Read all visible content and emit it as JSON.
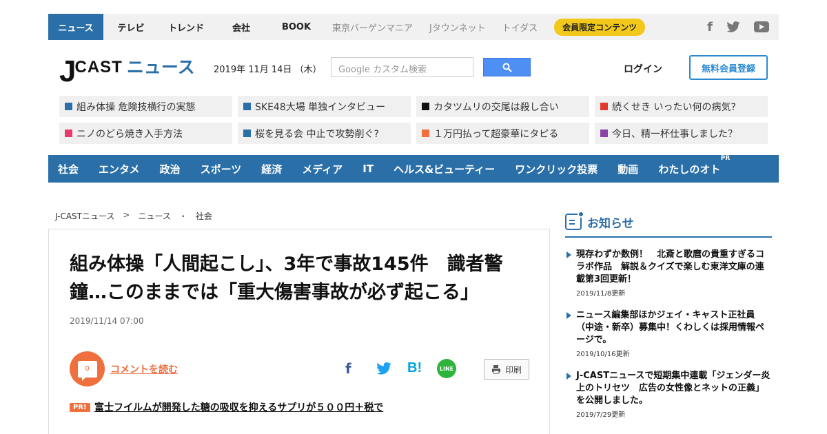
{
  "topnav": {
    "active": "ニュース",
    "tabs": [
      "テレビ",
      "トレンド",
      "会社",
      "BOOK"
    ],
    "grey_tabs": [
      "東京バーゲンマニア",
      "Jタウンネット",
      "トイダス"
    ],
    "member": "会員限定コンテンツ",
    "social": {
      "facebook": "f",
      "twitter": "🐦"
    }
  },
  "header": {
    "logo_j": "J",
    "logo_cast": "CAST",
    "logo_news": "ニュース",
    "date": "2019年 11月 14日 （木）",
    "search_placeholder": "Google カスタム検索",
    "login": "ログイン",
    "register": "無料会員登録"
  },
  "trending": [
    {
      "text": "組み体操 危険技横行の実態",
      "color": "#2a6fa8"
    },
    {
      "text": "SKE48大場 単独インタビュー",
      "color": "#2a6fa8"
    },
    {
      "text": "カタツムリの交尾は殺し合い",
      "color": "#111111"
    },
    {
      "text": "続くせき いったい何の病気?",
      "color": "#e23b2e"
    },
    {
      "text": "ニノのどら焼き入手方法",
      "color": "#e83a6e"
    },
    {
      "text": "桜を見る会 中止で攻勢削ぐ?",
      "color": "#2a6fa8"
    },
    {
      "text": "１万円払って超豪華にタピる",
      "color": "#ef6f3d"
    },
    {
      "text": "今日、精一杯仕事しました？",
      "color": "#8b45a8"
    }
  ],
  "categories": [
    "社会",
    "エンタメ",
    "政治",
    "スポーツ",
    "経済",
    "メディア",
    "IT",
    "ヘルス&ビューティー",
    "ワンクリック投票",
    "動画",
    "わたしのオト"
  ],
  "category_pr": "PR",
  "breadcrumb": {
    "home": "J-CASTニュース",
    "sep1": ">",
    "section": "ニュース",
    "sep2": "・",
    "sub": "社会"
  },
  "article": {
    "title": "組み体操「人間起こし」、3年で事故145件　識者警鐘…このままでは「重大傷害事故が必ず起こる」",
    "date": "2019/11/14 07:00",
    "comment_count": "0",
    "comment_link": "コメントを読む",
    "share": {
      "facebook": "f",
      "twitter": "🐦",
      "hatena": "B!",
      "line": "LINE"
    },
    "print": "印刷",
    "pr_badge": "PR!",
    "pr_link": "富士フイルムが開発した糖の吸収を抑えるサプリが５００円＋税で"
  },
  "sidebar": {
    "title": "お知らせ",
    "items": [
      {
        "text": "現存わずか数例！　北斎と歌麿の貴重すぎるコラボ作品　解説＆クイズで楽しむ東洋文庫の連載第3回更新！",
        "date": "2019/11/8更新"
      },
      {
        "text": "ニュース編集部ほかジェイ・キャスト正社員（中途・新卒）募集中！くわしくは採用情報ページで。",
        "date": "2019/10/16更新"
      },
      {
        "text": "J-CASTニュースで短期集中連載「ジェンダー炎上のトリセツ　広告の女性像とネットの正義」を公開しました。",
        "date": "2019/7/29更新"
      }
    ]
  }
}
